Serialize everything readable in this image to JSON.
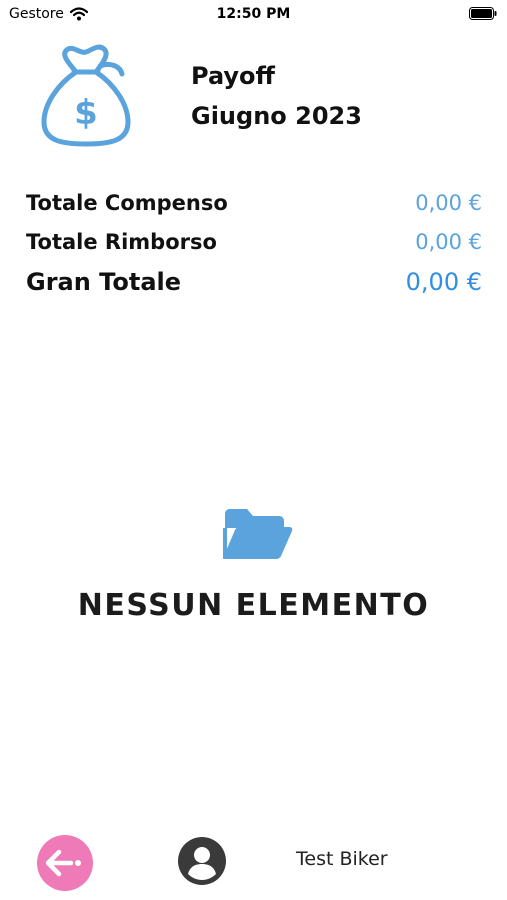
{
  "status_bar": {
    "carrier": "Gestore",
    "time": "12:50 PM"
  },
  "header": {
    "title": "Payoff",
    "period": "Giugno 2023",
    "icon": "money-bag-icon"
  },
  "totals": {
    "compenso_label": "Totale Compenso",
    "compenso_value": "0,00 €",
    "rimborso_label": "Totale Rimborso",
    "rimborso_value": "0,00 €",
    "gran_label": "Gran Totale",
    "gran_value": "0,00 €"
  },
  "empty_state": {
    "icon": "folder-icon",
    "text": "NESSUN ELEMENTO"
  },
  "bottom_bar": {
    "back_icon": "arrow-left-icon",
    "avatar_icon": "user-avatar-icon",
    "user_name": "Test Biker"
  },
  "colors": {
    "accent_blue": "#5aa3dc",
    "back_button_pink": "#ee7ab8",
    "avatar_gray": "#3a3a3a"
  }
}
